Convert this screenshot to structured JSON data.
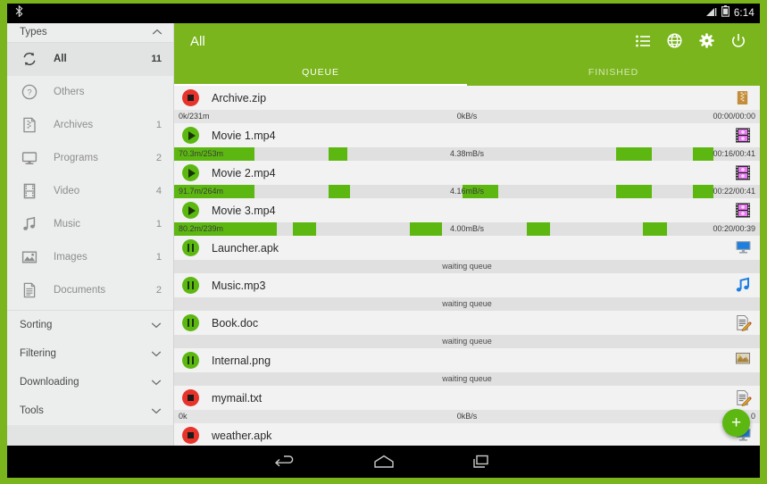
{
  "theme": {
    "accent": "#7ab51d",
    "progress": "#5cb811",
    "stopped": "#e8332a",
    "sidebar_bg": "#eceded",
    "list_bg": "#efefef"
  },
  "statusbar": {
    "clock": "6:14",
    "icons": [
      "signal-icon",
      "battery-icon"
    ]
  },
  "sidebar": {
    "header": {
      "label": "Types",
      "chevron": "chevron-up-icon"
    },
    "items": [
      {
        "icon": "refresh-icon",
        "label": "All",
        "count": "11",
        "active": true
      },
      {
        "icon": "question-icon",
        "label": "Others",
        "count": "",
        "active": false
      },
      {
        "icon": "archive-icon",
        "label": "Archives",
        "count": "1",
        "active": false
      },
      {
        "icon": "monitor-icon",
        "label": "Programs",
        "count": "2",
        "active": false
      },
      {
        "icon": "film-icon",
        "label": "Video",
        "count": "4",
        "active": false
      },
      {
        "icon": "music-icon",
        "label": "Music",
        "count": "1",
        "active": false
      },
      {
        "icon": "image-icon",
        "label": "Images",
        "count": "1",
        "active": false
      },
      {
        "icon": "document-icon",
        "label": "Documents",
        "count": "2",
        "active": false
      }
    ],
    "sections": [
      {
        "label": "Sorting",
        "chevron": "chevron-down-icon"
      },
      {
        "label": "Filtering",
        "chevron": "chevron-down-icon"
      },
      {
        "label": "Downloading",
        "chevron": "chevron-down-icon"
      },
      {
        "label": "Tools",
        "chevron": "chevron-down-icon"
      }
    ]
  },
  "appbar": {
    "title": "All",
    "actions": [
      {
        "icon": "list-icon"
      },
      {
        "icon": "globe-icon"
      },
      {
        "icon": "gear-icon"
      },
      {
        "icon": "power-icon"
      }
    ],
    "tabs": [
      {
        "label": "QUEUE",
        "selected": true
      },
      {
        "label": "FINISHED",
        "selected": false
      }
    ]
  },
  "fab": {
    "icon": "plus-icon",
    "label": "+"
  },
  "navbar": {
    "buttons": [
      {
        "icon": "back-icon"
      },
      {
        "icon": "home-icon"
      },
      {
        "icon": "recents-icon"
      }
    ]
  },
  "downloads": [
    {
      "name": "Archive.zip",
      "state": "stopped",
      "filetype": "zip-icon",
      "bar": {
        "mode": "idle",
        "left": "0k/231m",
        "center": "0kB/s",
        "right": "00:00/00:00",
        "segments": []
      }
    },
    {
      "name": "Movie 1.mp4",
      "state": "playing",
      "filetype": "video-icon",
      "bar": {
        "mode": "progress",
        "left": "70.3m/253m",
        "center": "4.38mB/s",
        "right": "00:16/00:41",
        "segments": [
          {
            "left_pct": 0.0,
            "width_pct": 13.7
          },
          {
            "left_pct": 26.4,
            "width_pct": 3.2
          },
          {
            "left_pct": 75.5,
            "width_pct": 6.1
          },
          {
            "left_pct": 88.6,
            "width_pct": 3.5
          }
        ]
      }
    },
    {
      "name": "Movie 2.mp4",
      "state": "playing",
      "filetype": "video-icon",
      "bar": {
        "mode": "progress",
        "left": "91.7m/264m",
        "center": "4.16mB/s",
        "right": "00:22/00:41",
        "segments": [
          {
            "left_pct": 0.0,
            "width_pct": 13.7
          },
          {
            "left_pct": 26.4,
            "width_pct": 3.6
          },
          {
            "left_pct": 49.2,
            "width_pct": 6.1
          },
          {
            "left_pct": 75.5,
            "width_pct": 6.1
          },
          {
            "left_pct": 88.6,
            "width_pct": 3.5
          }
        ]
      }
    },
    {
      "name": "Movie 3.mp4",
      "state": "playing",
      "filetype": "video-icon",
      "bar": {
        "mode": "progress",
        "left": "80.2m/239m",
        "center": "4.00mB/s",
        "right": "00:20/00:39",
        "segments": [
          {
            "left_pct": 0.0,
            "width_pct": 17.5
          },
          {
            "left_pct": 20.3,
            "width_pct": 4.0
          },
          {
            "left_pct": 40.2,
            "width_pct": 5.6
          },
          {
            "left_pct": 60.2,
            "width_pct": 4.0
          },
          {
            "left_pct": 80.1,
            "width_pct": 4.0
          }
        ]
      }
    },
    {
      "name": "Launcher.apk",
      "state": "paused",
      "filetype": "monitor-icon",
      "bar": {
        "mode": "wait",
        "left": "",
        "center": "waiting queue",
        "right": "",
        "segments": []
      }
    },
    {
      "name": "Music.mp3",
      "state": "paused",
      "filetype": "music-icon",
      "bar": {
        "mode": "wait",
        "left": "",
        "center": "waiting queue",
        "right": "",
        "segments": []
      }
    },
    {
      "name": "Book.doc",
      "state": "paused",
      "filetype": "doc-icon",
      "bar": {
        "mode": "wait",
        "left": "",
        "center": "waiting queue",
        "right": "",
        "segments": []
      }
    },
    {
      "name": "Internal.png",
      "state": "paused",
      "filetype": "picture-icon",
      "bar": {
        "mode": "wait",
        "left": "",
        "center": "waiting queue",
        "right": "",
        "segments": []
      }
    },
    {
      "name": "mymail.txt",
      "state": "stopped",
      "filetype": "doc-icon",
      "bar": {
        "mode": "idle",
        "left": "0k",
        "center": "0kB/s",
        "right": "0",
        "segments": []
      }
    },
    {
      "name": "weather.apk",
      "state": "stopped",
      "filetype": "monitor-icon",
      "bar": {
        "mode": "none",
        "left": "",
        "center": "",
        "right": "",
        "segments": []
      }
    }
  ]
}
